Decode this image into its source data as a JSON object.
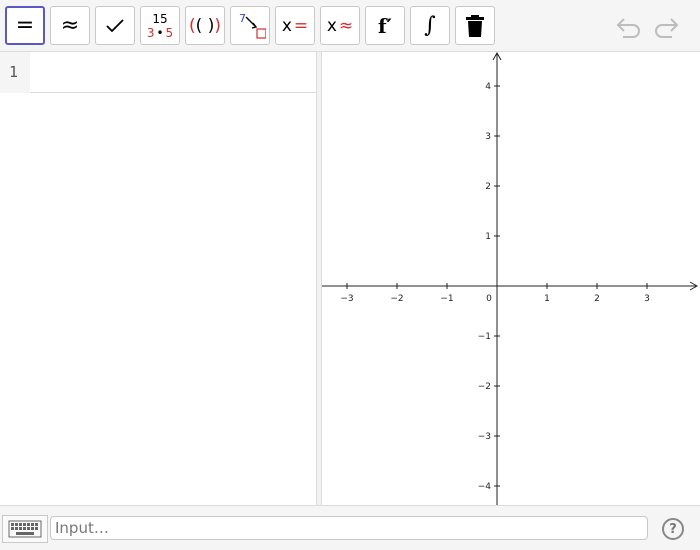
{
  "toolbar": {
    "tools": {
      "equals": "=",
      "approx": "≈",
      "check": "✓",
      "factor_top": "15",
      "factor_left": "3",
      "factor_dot": "•",
      "factor_right": "5",
      "expand_inner": "( )",
      "expand_open": "(",
      "expand_close": ")",
      "subst_number": "7",
      "solve_x": "x",
      "solve_eq": "=",
      "nsolve_x": "x",
      "nsolve_approx": "≈",
      "derivative": "f′",
      "integral": "∫"
    },
    "icons": {
      "delete": "trash-icon",
      "undo": "undo-icon",
      "redo": "redo-icon"
    }
  },
  "algebra": {
    "rows": [
      {
        "number": "1",
        "value": ""
      }
    ]
  },
  "graphics": {
    "x_ticks": [
      "−3",
      "−2",
      "−1",
      "0",
      "1",
      "2",
      "3"
    ],
    "y_ticks": [
      "4",
      "3",
      "2",
      "1",
      "−1",
      "−2",
      "−3",
      "−4"
    ]
  },
  "input_bar": {
    "placeholder": "Input…",
    "value": "",
    "help": "?"
  },
  "colors": {
    "accent": "#5a57c6",
    "red": "#d32f2f",
    "border": "#c8c8c8"
  }
}
